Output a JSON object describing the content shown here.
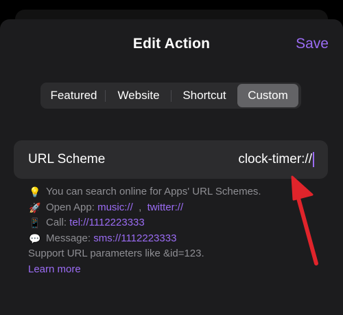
{
  "header": {
    "title": "Edit Action",
    "save_label": "Save"
  },
  "segments": [
    {
      "label": "Featured",
      "selected": false
    },
    {
      "label": "Website",
      "selected": false
    },
    {
      "label": "Shortcut",
      "selected": false
    },
    {
      "label": "Custom",
      "selected": true
    }
  ],
  "url_field": {
    "label": "URL Scheme",
    "value": "clock-timer://"
  },
  "info": {
    "tip": {
      "icon": "lightbulb-icon",
      "emoji": "💡",
      "text": "You can search online for Apps' URL Schemes."
    },
    "open_app": {
      "icon": "rocket-icon",
      "emoji": "🚀",
      "prefix": "Open App:",
      "link1": "music://",
      "sep": ",",
      "link2": "twitter://"
    },
    "call": {
      "icon": "phone-icon",
      "emoji": "📱",
      "prefix": "Call:",
      "link": "tel://1112223333"
    },
    "message": {
      "icon": "speech-bubble-icon",
      "emoji": "💬",
      "prefix": "Message:",
      "link": "sms://1112223333"
    },
    "params": "Support URL parameters like &id=123.",
    "learn_more": "Learn more"
  },
  "colors": {
    "accent": "#9b6cf4",
    "annotation_arrow": "#e0242b"
  }
}
